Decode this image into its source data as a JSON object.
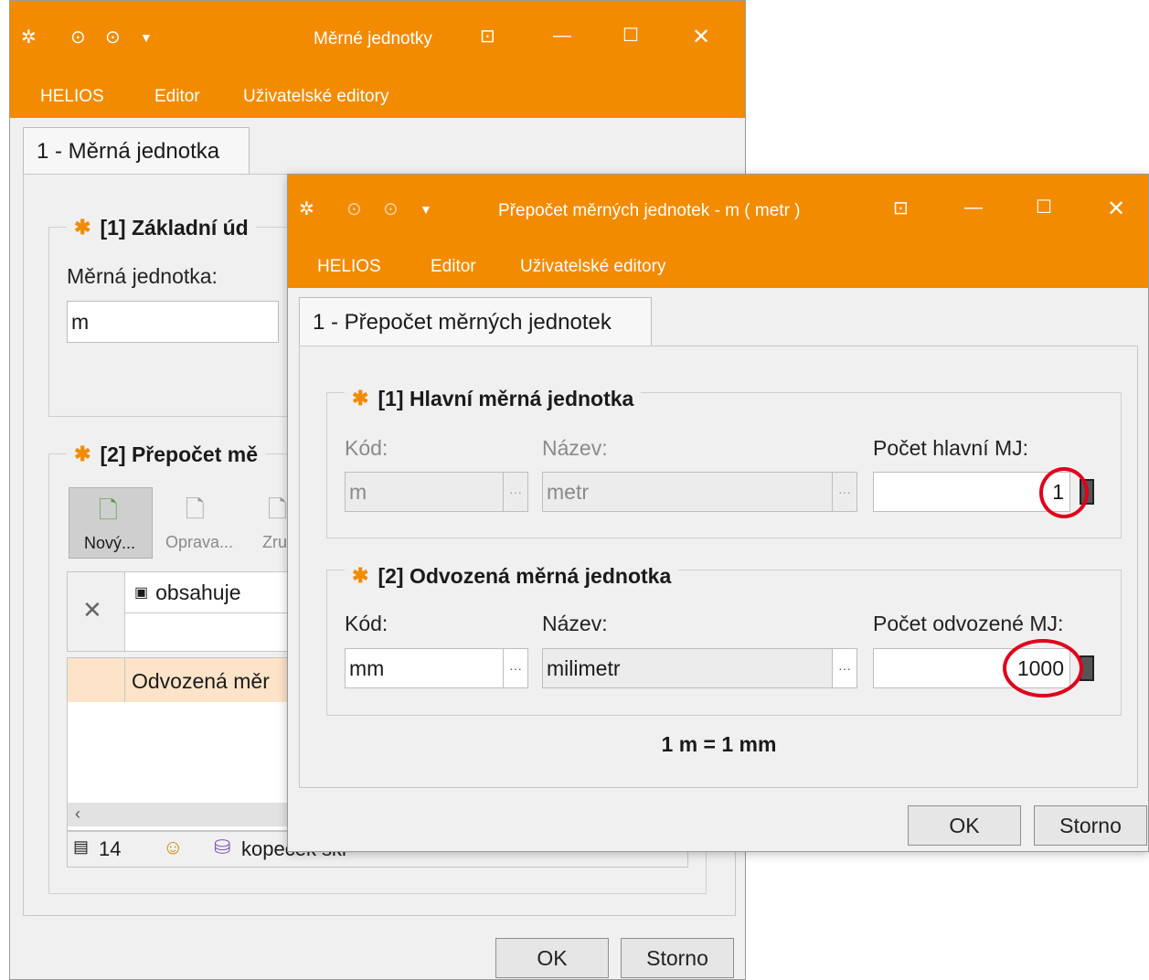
{
  "back_window": {
    "title": "Měrné jednotky",
    "menu": [
      "HELIOS",
      "Editor",
      "Uživatelské editory"
    ],
    "tab_label": "1 - Měrná jednotka",
    "group1_title": "[1] Základní úd",
    "field_label": "Měrná jednotka:",
    "field_value": "m",
    "group2_title": "[2] Přepočet mě",
    "toolbar": {
      "new_label": "Nový...",
      "edit_label": "Oprava...",
      "cancel_label": "Zru"
    },
    "filter_text": "obsahuje",
    "grid_header": "Odvozená měr",
    "status": {
      "rows": "14",
      "db_label": "kopeček ski"
    },
    "ok_label": "OK",
    "cancel_label": "Storno"
  },
  "front_window": {
    "title": "Přepočet měrných jednotek - m ( metr )",
    "menu": [
      "HELIOS",
      "Editor",
      "Uživatelské editory"
    ],
    "tab_label": "1 - Přepočet měrných jednotek",
    "group1": {
      "title": "[1] Hlavní měrná jednotka",
      "code_label": "Kód:",
      "name_label": "Název:",
      "count_label": "Počet hlavní MJ:",
      "code_value": "m",
      "name_value": "metr",
      "count_value": "1"
    },
    "group2": {
      "title": "[2] Odvozená měrná jednotka",
      "code_label": "Kód:",
      "name_label": "Název:",
      "count_label": "Počet odvozené MJ:",
      "code_value": "mm",
      "name_value": "milimetr",
      "count_value": "1000"
    },
    "formula": "1 m = 1 mm",
    "ok_label": "OK",
    "cancel_label": "Storno"
  },
  "colors": {
    "accent": "#f28b00",
    "annotation": "#e0001b"
  }
}
